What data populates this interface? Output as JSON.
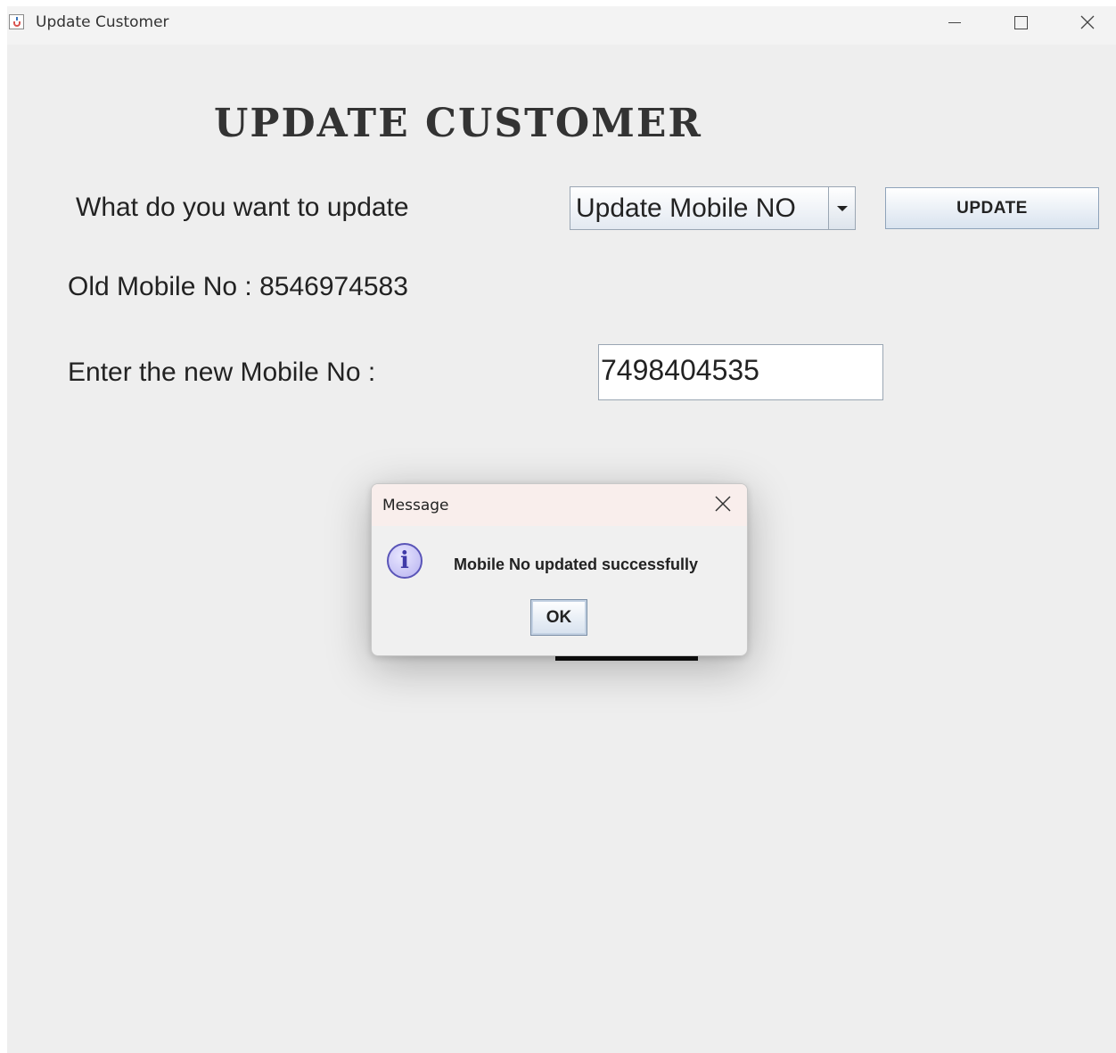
{
  "window": {
    "title": "Update Customer",
    "icon": "java-cup-icon"
  },
  "form": {
    "heading": "UPDATE CUSTOMER",
    "prompt_label": "What do you want to update",
    "combo_selected": "Update Mobile NO",
    "update_button": "UPDATE",
    "old_mobile_label": "Old Mobile No : 8546974583",
    "new_mobile_label": "Enter the new Mobile No :",
    "new_mobile_value": "7498404535"
  },
  "dialog": {
    "title": "Message",
    "icon": "info-icon",
    "message": "Mobile No updated successfully",
    "ok_button": "OK"
  }
}
